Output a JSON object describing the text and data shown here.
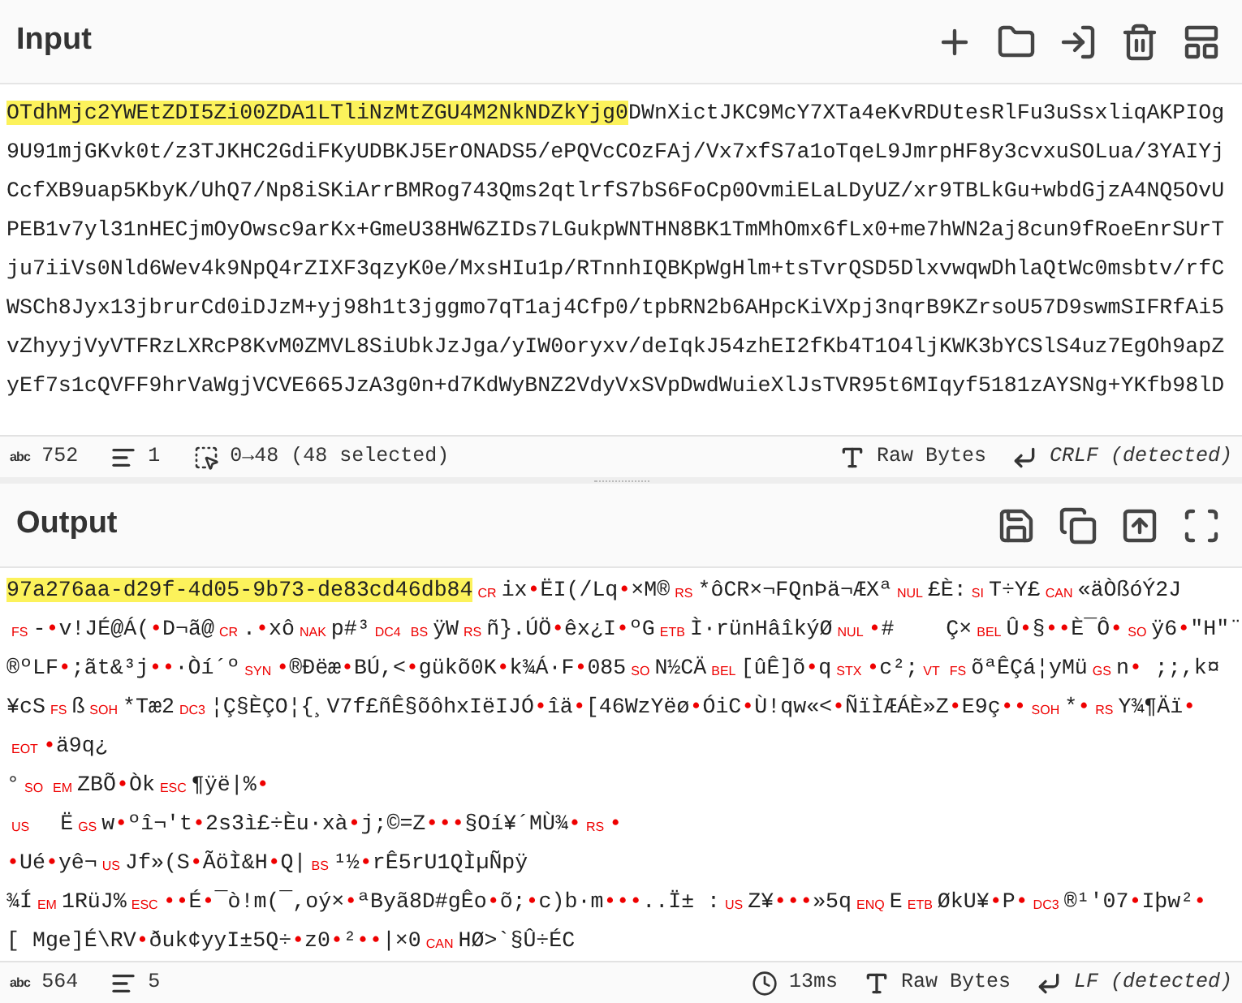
{
  "input": {
    "title": "Input",
    "toolbar": [
      {
        "kind": "add"
      },
      {
        "kind": "open-folder"
      },
      {
        "kind": "load"
      },
      {
        "kind": "delete"
      },
      {
        "kind": "layout"
      }
    ],
    "text_selected": "OTdhMjc2YWEtZDI5Zi00ZDA1LTliNzMtZGU4M2NkNDZkYjg0",
    "text_rest": "DWnXictJKC9McY7XTa4eKvRDUtesRlFu3uSsxliqAKPIOg9U91mjGKvk0t/z3TJKHC2GdiFKyUDBKJ5ErONADS5/ePQVcCOzFAj/Vx7xfS7a1oTqeL9JmrpHF8y3cvxuSOLua/3YAIYjCcfXB9uap5KbyK/UhQ7/Np8iSKiArrBMRog743Qms2qtlrfS7bS6FoCp0OvmiELaLDyUZ/xr9TBLkGu+wbdGjzA4NQ5OvUPEB1v7yl31nHECjmOyOwsc9arKx+GmeU38HW6ZIDs7LGukpWNTHN8BK1TmMhOmx6fLx0+me7hWN2aj8cun9fRoeEnrSUrTju7iiVs0Nld6Wev4k9NpQ4rZIXF3qzyK0e/MxsHIu1p/RTnnhIQBKpWgHlm+tsTvrQSD5DlxvwqwDhlaQtWc0msbtv/rfCWSCh8Jyx13jbrurCd0iDJzM+yj98h1t3jggmo7qT1aj4Cfp0/tpbRN2b6AHpcKiVXpj3nqrB9KZrsoU57D9swmSIFRfAi5vZhyyjVyVTFRzLXRcP8KvM0ZMVL8SiUbkJzJga/yIW0oryxv/deIqkJ54zhEI2fKb4T1O4ljKWK3bYCSlS4uz7EgOh9apZyEf7s1cQVFF9hrVaWgjVCVE665JzA3g0n+d7KdWyBNZ2VdyVxSVpDwdWuieXlJsTVR95t6MIqyf5181zAYSNg+YKfb98lD",
    "status": [
      {
        "kind": "length",
        "icon_text": "abc",
        "text": "752"
      },
      {
        "kind": "lines",
        "text": "1"
      },
      {
        "kind": "selection",
        "text": "0→48 (48 selected)"
      }
    ],
    "status_right": [
      {
        "kind": "encoding",
        "text": "Raw Bytes"
      },
      {
        "kind": "eol",
        "text": "CRLF (detected)"
      }
    ]
  },
  "output": {
    "title": "Output",
    "toolbar": [
      {
        "kind": "save"
      },
      {
        "kind": "copy"
      },
      {
        "kind": "replace-input"
      },
      {
        "kind": "maximise"
      }
    ],
    "lines": [
      [
        {
          "kind": "selected",
          "text": "97a276aa-d29f-4d05-9b73-de83cd46db84"
        },
        {
          "kind": "ctrl",
          "text": "CR"
        },
        {
          "kind": "text",
          "text": "ix"
        },
        {
          "kind": "dot",
          "text": "•"
        },
        {
          "kind": "text",
          "text": "ËI(/Lq"
        },
        {
          "kind": "dot",
          "text": "•"
        },
        {
          "kind": "text",
          "text": "×M®"
        },
        {
          "kind": "ctrl",
          "text": "RS"
        },
        {
          "kind": "text",
          "text": "*ôCR×¬FQnÞä¬ÆXª"
        },
        {
          "kind": "ctrl",
          "text": "NUL"
        },
        {
          "kind": "text",
          "text": "£È:"
        },
        {
          "kind": "ctrl",
          "text": "SI"
        },
        {
          "kind": "text",
          "text": "T÷Y£"
        },
        {
          "kind": "ctrl",
          "text": "CAN"
        },
        {
          "kind": "text",
          "text": "«äÒßóÝ2J"
        }
      ],
      [
        {
          "kind": "ctrl",
          "text": "FS"
        },
        {
          "kind": "text",
          "text": "-"
        },
        {
          "kind": "dot",
          "text": "•"
        },
        {
          "kind": "text",
          "text": "v!JÉ@Á("
        },
        {
          "kind": "dot",
          "text": "•"
        },
        {
          "kind": "text",
          "text": "D¬ã@"
        },
        {
          "kind": "ctrl",
          "text": "CR"
        },
        {
          "kind": "text",
          "text": "."
        },
        {
          "kind": "dot",
          "text": "•"
        },
        {
          "kind": "text",
          "text": "xô"
        },
        {
          "kind": "ctrl",
          "text": "NAK"
        },
        {
          "kind": "text",
          "text": "p#³"
        },
        {
          "kind": "ctrl",
          "text": "DC4"
        },
        {
          "kind": "ctrl",
          "text": "BS"
        },
        {
          "kind": "text",
          "text": "ÿW"
        },
        {
          "kind": "ctrl",
          "text": "RS"
        },
        {
          "kind": "text",
          "text": "ñ}.ÚÖ"
        },
        {
          "kind": "dot",
          "text": "•"
        },
        {
          "kind": "text",
          "text": "êx¿I"
        },
        {
          "kind": "dot",
          "text": "•"
        },
        {
          "kind": "text",
          "text": "ºG"
        },
        {
          "kind": "ctrl",
          "text": "ETB"
        },
        {
          "kind": "text",
          "text": "Ì·rünHâîkýØ"
        },
        {
          "kind": "ctrl",
          "text": "NUL"
        },
        {
          "kind": "dot",
          "text": "•"
        },
        {
          "kind": "text",
          "text": "#    Ç×"
        },
        {
          "kind": "ctrl",
          "text": "BEL"
        },
        {
          "kind": "text",
          "text": "Û"
        },
        {
          "kind": "dot",
          "text": "•"
        },
        {
          "kind": "text",
          "text": "§"
        },
        {
          "kind": "dot",
          "text": "••"
        },
        {
          "kind": "text",
          "text": "È¯Ô"
        },
        {
          "kind": "dot",
          "text": "•"
        },
        {
          "kind": "ctrl",
          "text": "SO"
        },
        {
          "kind": "text",
          "text": "ÿ6"
        },
        {
          "kind": "dot",
          "text": "•"
        },
        {
          "kind": "text",
          "text": "\"H\"¨"
        }
      ],
      [
        {
          "kind": "text",
          "text": "®ºLF"
        },
        {
          "kind": "dot",
          "text": "•"
        },
        {
          "kind": "text",
          "text": ";ãt&³j"
        },
        {
          "kind": "dot",
          "text": "••"
        },
        {
          "kind": "text",
          "text": "·Òí´º"
        },
        {
          "kind": "ctrl",
          "text": "SYN"
        },
        {
          "kind": "dot",
          "text": "•"
        },
        {
          "kind": "text",
          "text": "®Ðëæ"
        },
        {
          "kind": "dot",
          "text": "•"
        },
        {
          "kind": "text",
          "text": "BÚ,<"
        },
        {
          "kind": "dot",
          "text": "•"
        },
        {
          "kind": "text",
          "text": "gükõ0K"
        },
        {
          "kind": "dot",
          "text": "•"
        },
        {
          "kind": "text",
          "text": "k¾Á·F"
        },
        {
          "kind": "dot",
          "text": "•"
        },
        {
          "kind": "text",
          "text": "085"
        },
        {
          "kind": "ctrl",
          "text": "SO"
        },
        {
          "kind": "text",
          "text": "N½CÄ"
        },
        {
          "kind": "ctrl",
          "text": "BEL"
        },
        {
          "kind": "text",
          "text": "[ûÊ]õ"
        },
        {
          "kind": "dot",
          "text": "•"
        },
        {
          "kind": "text",
          "text": "q"
        },
        {
          "kind": "ctrl",
          "text": "STX"
        },
        {
          "kind": "dot",
          "text": "•"
        },
        {
          "kind": "text",
          "text": "c²;"
        },
        {
          "kind": "ctrl",
          "text": "VT"
        },
        {
          "kind": "ctrl",
          "text": "FS"
        },
        {
          "kind": "text",
          "text": "õªÊÇá¦yMü"
        },
        {
          "kind": "ctrl",
          "text": "GS"
        },
        {
          "kind": "text",
          "text": "n"
        },
        {
          "kind": "dot",
          "text": "•"
        },
        {
          "kind": "text",
          "text": " ;;,k¤"
        }
      ],
      [
        {
          "kind": "text",
          "text": "¥cS"
        },
        {
          "kind": "ctrl",
          "text": "FS"
        },
        {
          "kind": "text",
          "text": "ß"
        },
        {
          "kind": "ctrl",
          "text": "SOH"
        },
        {
          "kind": "text",
          "text": "*Tæ2"
        },
        {
          "kind": "ctrl",
          "text": "DC3"
        },
        {
          "kind": "text",
          "text": "¦Ç§ÈÇO¦{¸V7f£ñÊ§õôhxIëIJÓ"
        },
        {
          "kind": "dot",
          "text": "•"
        },
        {
          "kind": "text",
          "text": "îä"
        },
        {
          "kind": "dot",
          "text": "•"
        },
        {
          "kind": "text",
          "text": "[46WzYëø"
        },
        {
          "kind": "dot",
          "text": "•"
        },
        {
          "kind": "text",
          "text": "ÓiC"
        },
        {
          "kind": "dot",
          "text": "•"
        },
        {
          "kind": "text",
          "text": "Ù!qw«<"
        },
        {
          "kind": "dot",
          "text": "•"
        },
        {
          "kind": "text",
          "text": "ÑïÌÆÁÈ»Z"
        },
        {
          "kind": "dot",
          "text": "•"
        },
        {
          "kind": "text",
          "text": "E9ç"
        },
        {
          "kind": "dot",
          "text": "••"
        },
        {
          "kind": "ctrl",
          "text": "SOH"
        },
        {
          "kind": "text",
          "text": "*"
        },
        {
          "kind": "dot",
          "text": "•"
        },
        {
          "kind": "ctrl",
          "text": "RS"
        },
        {
          "kind": "text",
          "text": "Y¾¶Äï"
        },
        {
          "kind": "dot",
          "text": "•"
        }
      ],
      [
        {
          "kind": "ctrl",
          "text": "EOT"
        },
        {
          "kind": "dot",
          "text": "•"
        },
        {
          "kind": "text",
          "text": "ä9q¿"
        }
      ],
      [
        {
          "kind": "text",
          "text": "°"
        },
        {
          "kind": "ctrl",
          "text": "SO"
        },
        {
          "kind": "ctrl",
          "text": "EM"
        },
        {
          "kind": "text",
          "text": "ZBÕ"
        },
        {
          "kind": "dot",
          "text": "•"
        },
        {
          "kind": "text",
          "text": "Òk"
        },
        {
          "kind": "ctrl",
          "text": "ESC"
        },
        {
          "kind": "text",
          "text": "¶ÿë|%"
        },
        {
          "kind": "dot",
          "text": "•"
        }
      ],
      [
        {
          "kind": "ctrl",
          "text": "US"
        },
        {
          "kind": "text",
          "text": "  Ë"
        },
        {
          "kind": "ctrl",
          "text": "GS"
        },
        {
          "kind": "text",
          "text": "w"
        },
        {
          "kind": "dot",
          "text": "•"
        },
        {
          "kind": "text",
          "text": "ºî¬'t"
        },
        {
          "kind": "dot",
          "text": "•"
        },
        {
          "kind": "text",
          "text": "2s3ì£÷Èu·xà"
        },
        {
          "kind": "dot",
          "text": "•"
        },
        {
          "kind": "text",
          "text": "j;©=Z"
        },
        {
          "kind": "dot",
          "text": "•••"
        },
        {
          "kind": "text",
          "text": "§Oí¥´MÙ¾"
        },
        {
          "kind": "dot",
          "text": "•"
        },
        {
          "kind": "ctrl",
          "text": "RS"
        },
        {
          "kind": "dot",
          "text": "•"
        }
      ],
      [
        {
          "kind": "dot",
          "text": "•"
        },
        {
          "kind": "text",
          "text": "Ué"
        },
        {
          "kind": "dot",
          "text": "•"
        },
        {
          "kind": "text",
          "text": "yê¬"
        },
        {
          "kind": "ctrl",
          "text": "US"
        },
        {
          "kind": "text",
          "text": "Jf»(S"
        },
        {
          "kind": "dot",
          "text": "•"
        },
        {
          "kind": "text",
          "text": "ÃöÌ&H"
        },
        {
          "kind": "dot",
          "text": "•"
        },
        {
          "kind": "text",
          "text": "Q|"
        },
        {
          "kind": "ctrl",
          "text": "BS"
        },
        {
          "kind": "text",
          "text": "¹½"
        },
        {
          "kind": "dot",
          "text": "•"
        },
        {
          "kind": "text",
          "text": "rÊ5rU1QÌµÑpÿ"
        }
      ],
      [
        {
          "kind": "text",
          "text": "¾Í"
        },
        {
          "kind": "ctrl",
          "text": "EM"
        },
        {
          "kind": "text",
          "text": "1RüJ%"
        },
        {
          "kind": "ctrl",
          "text": "ESC"
        },
        {
          "kind": "dot",
          "text": "••"
        },
        {
          "kind": "text",
          "text": "É"
        },
        {
          "kind": "dot",
          "text": "•"
        },
        {
          "kind": "text",
          "text": "¯ò!m(¯,oý×"
        },
        {
          "kind": "dot",
          "text": "•"
        },
        {
          "kind": "text",
          "text": "ªByã8D#gÊo"
        },
        {
          "kind": "dot",
          "text": "•"
        },
        {
          "kind": "text",
          "text": "õ;"
        },
        {
          "kind": "dot",
          "text": "•"
        },
        {
          "kind": "text",
          "text": "c)b·m"
        },
        {
          "kind": "dot",
          "text": "•••"
        },
        {
          "kind": "text",
          "text": "..Ï± :"
        },
        {
          "kind": "ctrl",
          "text": "US"
        },
        {
          "kind": "text",
          "text": "Z¥"
        },
        {
          "kind": "dot",
          "text": "•••"
        },
        {
          "kind": "text",
          "text": "»5q"
        },
        {
          "kind": "ctrl",
          "text": "ENQ"
        },
        {
          "kind": "text",
          "text": "E"
        },
        {
          "kind": "ctrl",
          "text": "ETB"
        },
        {
          "kind": "text",
          "text": "ØkU¥"
        },
        {
          "kind": "dot",
          "text": "•"
        },
        {
          "kind": "text",
          "text": "P"
        },
        {
          "kind": "dot",
          "text": "•"
        },
        {
          "kind": "ctrl",
          "text": "DC3"
        },
        {
          "kind": "text",
          "text": "®¹'07"
        },
        {
          "kind": "dot",
          "text": "•"
        },
        {
          "kind": "text",
          "text": "Iþw²"
        },
        {
          "kind": "dot",
          "text": "•"
        }
      ],
      [
        {
          "kind": "text",
          "text": "[ Mge]É\\RV"
        },
        {
          "kind": "dot",
          "text": "•"
        },
        {
          "kind": "text",
          "text": "ðuk¢yyI±5Q÷"
        },
        {
          "kind": "dot",
          "text": "•"
        },
        {
          "kind": "text",
          "text": "z0"
        },
        {
          "kind": "dot",
          "text": "•"
        },
        {
          "kind": "text",
          "text": "²"
        },
        {
          "kind": "dot",
          "text": "••"
        },
        {
          "kind": "text",
          "text": "|×0"
        },
        {
          "kind": "ctrl",
          "text": "CAN"
        },
        {
          "kind": "text",
          "text": "HØ>`§Û÷ÉC"
        }
      ]
    ],
    "status": [
      {
        "kind": "length",
        "icon_text": "abc",
        "text": "564"
      },
      {
        "kind": "lines",
        "text": "5"
      }
    ],
    "status_right": [
      {
        "kind": "time",
        "text": "13ms"
      },
      {
        "kind": "encoding",
        "text": "Raw Bytes"
      },
      {
        "kind": "eol",
        "text": "LF (detected)"
      }
    ]
  }
}
